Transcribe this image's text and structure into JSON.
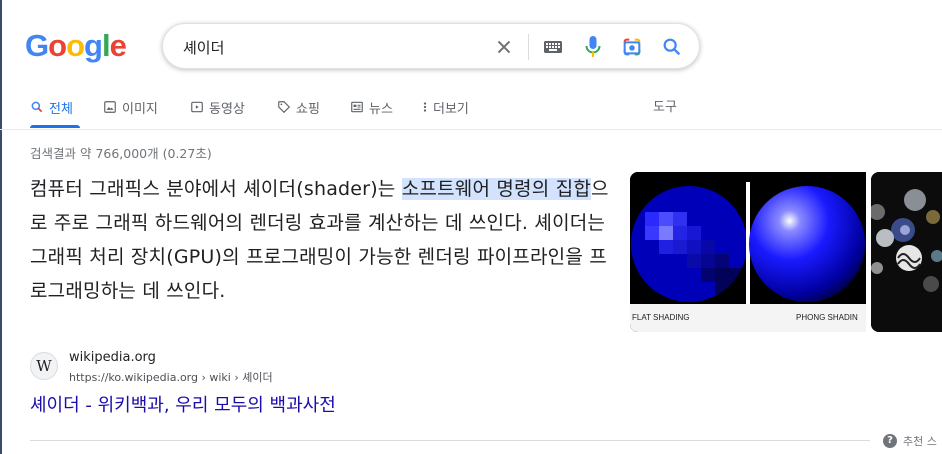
{
  "logo": {
    "letters": [
      "G",
      "o",
      "o",
      "g",
      "l",
      "e"
    ],
    "colors": [
      "#4285f4",
      "#ea4335",
      "#fbbc05",
      "#4285f4",
      "#34a853",
      "#ea4335"
    ]
  },
  "search": {
    "query": "셰이더"
  },
  "tabs": [
    {
      "label": "전체",
      "icon": "search-icon",
      "active": true
    },
    {
      "label": "이미지",
      "icon": "image-icon",
      "active": false
    },
    {
      "label": "동영상",
      "icon": "video-icon",
      "active": false
    },
    {
      "label": "쇼핑",
      "icon": "tag-icon",
      "active": false
    },
    {
      "label": "뉴스",
      "icon": "news-icon",
      "active": false
    },
    {
      "label": "더보기",
      "icon": "more-vert-icon",
      "active": false
    }
  ],
  "tools_label": "도구",
  "result_stats": "검색결과 약 766,000개 (0.27초)",
  "snippet": {
    "before": "컴퓨터 그래픽스 분야에서 셰이더(shader)는 ",
    "highlight": "소프트웨어 명령의 집합",
    "after": "으로 주로 그래픽 하드웨어의 렌더링 효과를 계산하는 데 쓰인다. 셰이더는 그래픽 처리 장치(GPU)의 프로그래밍이 가능한 렌더링 파이프라인을 프로그래밍하는 데 쓰인다."
  },
  "images": {
    "label_left": "FLAT SHADING",
    "label_right": "PHONG SHADIN"
  },
  "source": {
    "icon_letter": "W",
    "name": "wikipedia.org",
    "url": "https://ko.wikipedia.org › wiki › 셰이더",
    "title": "셰이더 - 위키백과, 우리 모두의 백과사전"
  },
  "feedback": {
    "label": "추천 스"
  },
  "colors": {
    "accent": "#1a73e8",
    "link": "#1a0dab",
    "highlight": "#d3e3fd"
  }
}
